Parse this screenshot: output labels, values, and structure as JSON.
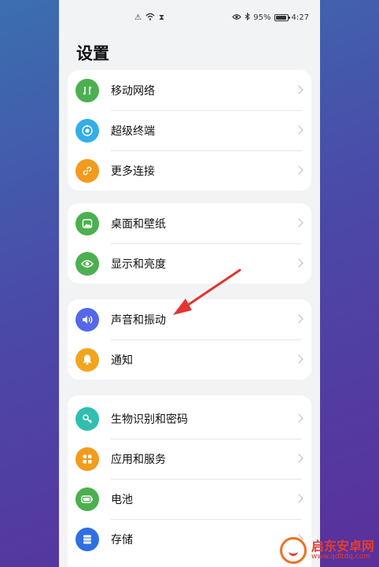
{
  "status_bar": {
    "battery_percent": "95%",
    "time": "4:27"
  },
  "page": {
    "title": "设置"
  },
  "groups": [
    {
      "items": [
        {
          "label": "移动网络",
          "icon": "mobile-network-icon",
          "color": "#4cb050"
        },
        {
          "label": "超级终端",
          "icon": "super-device-icon",
          "color": "#32aee8"
        },
        {
          "label": "更多连接",
          "icon": "link-icon",
          "color": "#f29b1e"
        }
      ]
    },
    {
      "items": [
        {
          "label": "桌面和壁纸",
          "icon": "wallpaper-icon",
          "color": "#4cb050"
        },
        {
          "label": "显示和亮度",
          "icon": "eye-icon",
          "color": "#4cb050"
        }
      ]
    },
    {
      "items": [
        {
          "label": "声音和振动",
          "icon": "speaker-icon",
          "color": "#5468e8"
        },
        {
          "label": "通知",
          "icon": "bell-icon",
          "color": "#f2a51e"
        }
      ]
    },
    {
      "items": [
        {
          "label": "生物识别和密码",
          "icon": "key-icon",
          "color": "#2fbfb0"
        },
        {
          "label": "应用和服务",
          "icon": "apps-grid-icon",
          "color": "#f29b1e"
        },
        {
          "label": "电池",
          "icon": "battery-icon",
          "color": "#4cb050"
        },
        {
          "label": "存储",
          "icon": "storage-icon",
          "color": "#2f6fe0"
        }
      ]
    }
  ],
  "annotation": {
    "arrow_color": "#e3342f"
  },
  "watermark": {
    "title": "启东安卓网",
    "url": "www.qdltdq.com"
  }
}
